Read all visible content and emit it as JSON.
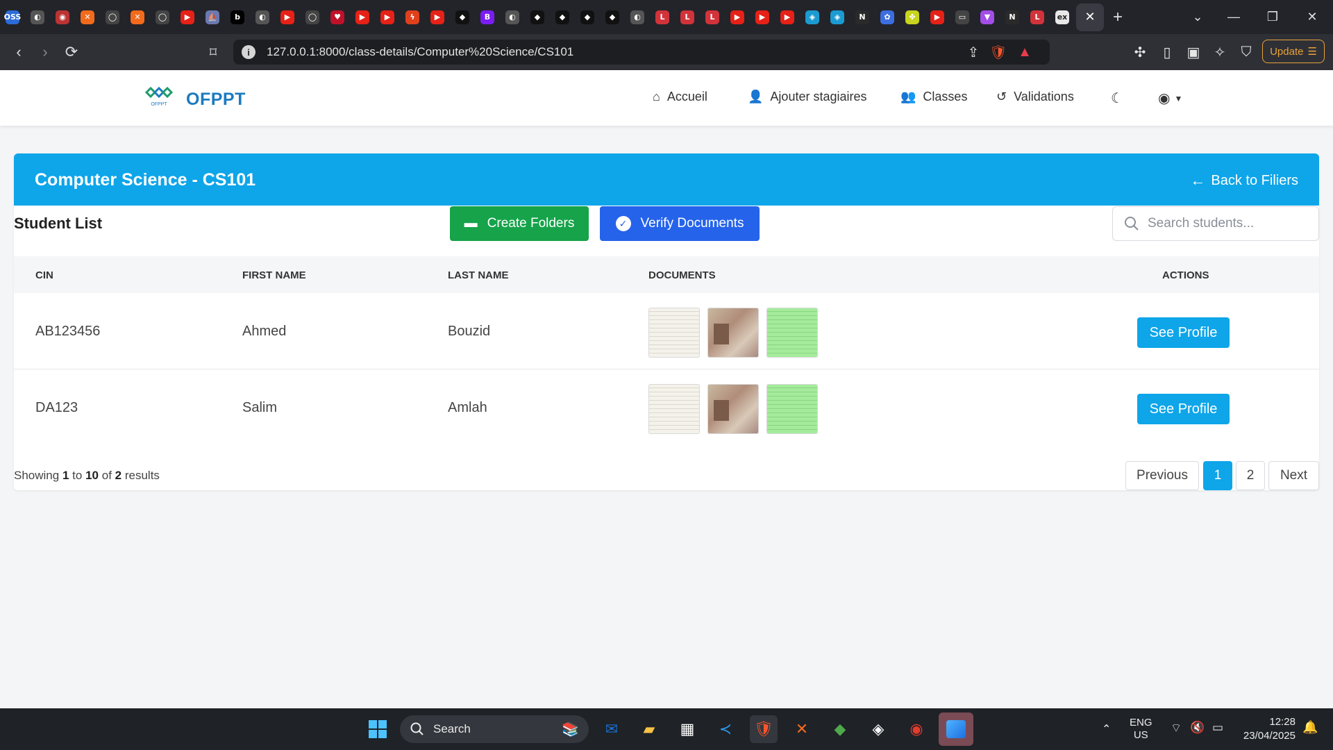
{
  "browser": {
    "url": "127.0.0.1:8000/class-details/Computer%20Science/CS101",
    "update_label": "Update",
    "tab_favicons": [
      {
        "name": "oss-tab",
        "text": "OSS",
        "color": "#2b6cd8"
      },
      {
        "name": "globe-tab",
        "text": "◐",
        "color": "#555"
      },
      {
        "name": "shield-tab",
        "text": "◉",
        "color": "#b33"
      },
      {
        "name": "xampp-tab",
        "text": "✕",
        "color": "#f26b1d"
      },
      {
        "name": "github-tab",
        "text": "◯",
        "color": "#444"
      },
      {
        "name": "xampp-tab-2",
        "text": "✕",
        "color": "#f26b1d"
      },
      {
        "name": "github-tab-2",
        "text": "◯",
        "color": "#444"
      },
      {
        "name": "youtube-tab",
        "text": "▶",
        "color": "#e62117"
      },
      {
        "name": "pma-tab",
        "text": "⛵",
        "color": "#6c78af"
      },
      {
        "name": "b-tab",
        "text": "b",
        "color": "#000"
      },
      {
        "name": "globe-tab-2",
        "text": "◐",
        "color": "#555"
      },
      {
        "name": "youtube-tab-2",
        "text": "▶",
        "color": "#e62117"
      },
      {
        "name": "github-tab-3",
        "text": "◯",
        "color": "#444"
      },
      {
        "name": "red-tab",
        "text": "♥",
        "color": "#c0112b"
      },
      {
        "name": "youtube-tab-3",
        "text": "▶",
        "color": "#e62117"
      },
      {
        "name": "youtube-tab-4",
        "text": "▶",
        "color": "#e62117"
      },
      {
        "name": "bolt-tab",
        "text": "ϟ",
        "color": "#e0401b"
      },
      {
        "name": "youtube-tab-5",
        "text": "▶",
        "color": "#e62117"
      },
      {
        "name": "cube-tab",
        "text": "◆",
        "color": "#111"
      },
      {
        "name": "bootstrap-tab",
        "text": "B",
        "color": "#7a1df2"
      },
      {
        "name": "globe-tab-3",
        "text": "◐",
        "color": "#555"
      },
      {
        "name": "cube-tab-2",
        "text": "◆",
        "color": "#111"
      },
      {
        "name": "cube-tab-3",
        "text": "◆",
        "color": "#111"
      },
      {
        "name": "cube-tab-4",
        "text": "◆",
        "color": "#111"
      },
      {
        "name": "cube-tab-5",
        "text": "◆",
        "color": "#111"
      },
      {
        "name": "globe-tab-4",
        "text": "◐",
        "color": "#555"
      },
      {
        "name": "laravel-tab",
        "text": "L",
        "color": "#d2333a"
      },
      {
        "name": "laravel-tab-2",
        "text": "L",
        "color": "#d2333a"
      },
      {
        "name": "laravel-tab-3",
        "text": "L",
        "color": "#d2333a"
      },
      {
        "name": "youtube-tab-6",
        "text": "▶",
        "color": "#e62117"
      },
      {
        "name": "youtube-tab-7",
        "text": "▶",
        "color": "#e62117"
      },
      {
        "name": "youtube-tab-8",
        "text": "▶",
        "color": "#e62117"
      },
      {
        "name": "map-tab",
        "text": "◈",
        "color": "#1b9bd1"
      },
      {
        "name": "map-tab-2",
        "text": "◈",
        "color": "#1b9bd1"
      },
      {
        "name": "notion-tab",
        "text": "N",
        "color": "#2a2a2a"
      },
      {
        "name": "copilot-tab",
        "text": "✿",
        "color": "#3c6ee0"
      },
      {
        "name": "openai-tab",
        "text": "✤",
        "color": "#c8d41d"
      },
      {
        "name": "youtube-tab-9",
        "text": "▶",
        "color": "#e62117"
      },
      {
        "name": "doc-tab",
        "text": "▭",
        "color": "#444"
      },
      {
        "name": "vite-tab",
        "text": "▼",
        "color": "#a34ee8"
      },
      {
        "name": "notion-tab-2",
        "text": "N",
        "color": "#2a2a2a"
      },
      {
        "name": "laravel-tab-4",
        "text": "L",
        "color": "#d2333a"
      },
      {
        "name": "ex-tab",
        "text": "ex",
        "color": "#e8e8e8"
      }
    ]
  },
  "navbar": {
    "brand": "OFPPT",
    "logo_caption": "OFPPT",
    "items": [
      {
        "label": "Accueil"
      },
      {
        "label": "Ajouter stagiaires"
      },
      {
        "label": "Classes"
      },
      {
        "label": "Validations"
      }
    ]
  },
  "card": {
    "title": "Computer Science - CS101",
    "back_label": "Back to Filiers",
    "list_title": "Student List",
    "create_folders": "Create Folders",
    "verify_documents": "Verify Documents",
    "search_placeholder": "Search students...",
    "columns": [
      "CIN",
      "FIRST NAME",
      "LAST NAME",
      "DOCUMENTS",
      "ACTIONS"
    ],
    "rows": [
      {
        "cin": "AB123456",
        "first_name": "Ahmed",
        "last_name": "Bouzid",
        "action": "See Profile"
      },
      {
        "cin": "DA123",
        "first_name": "Salim",
        "last_name": "Amlah",
        "action": "See Profile"
      }
    ],
    "showing": {
      "prefix": "Showing",
      "from": "1",
      "to_word": "to",
      "to": "10",
      "of_word": "of",
      "total": "2",
      "suffix": "results"
    },
    "pagination": {
      "previous": "Previous",
      "pages": [
        "1",
        "2"
      ],
      "next": "Next",
      "active_page": "1"
    }
  },
  "taskbar": {
    "search_label": "Search",
    "lang": "ENG",
    "region": "US",
    "time": "12:28",
    "date": "23/04/2025"
  },
  "colors": {
    "header_blue": "#0ea5e9",
    "create_green": "#16a34a",
    "verify_blue": "#2563eb",
    "brand": "#1c7bbf"
  }
}
